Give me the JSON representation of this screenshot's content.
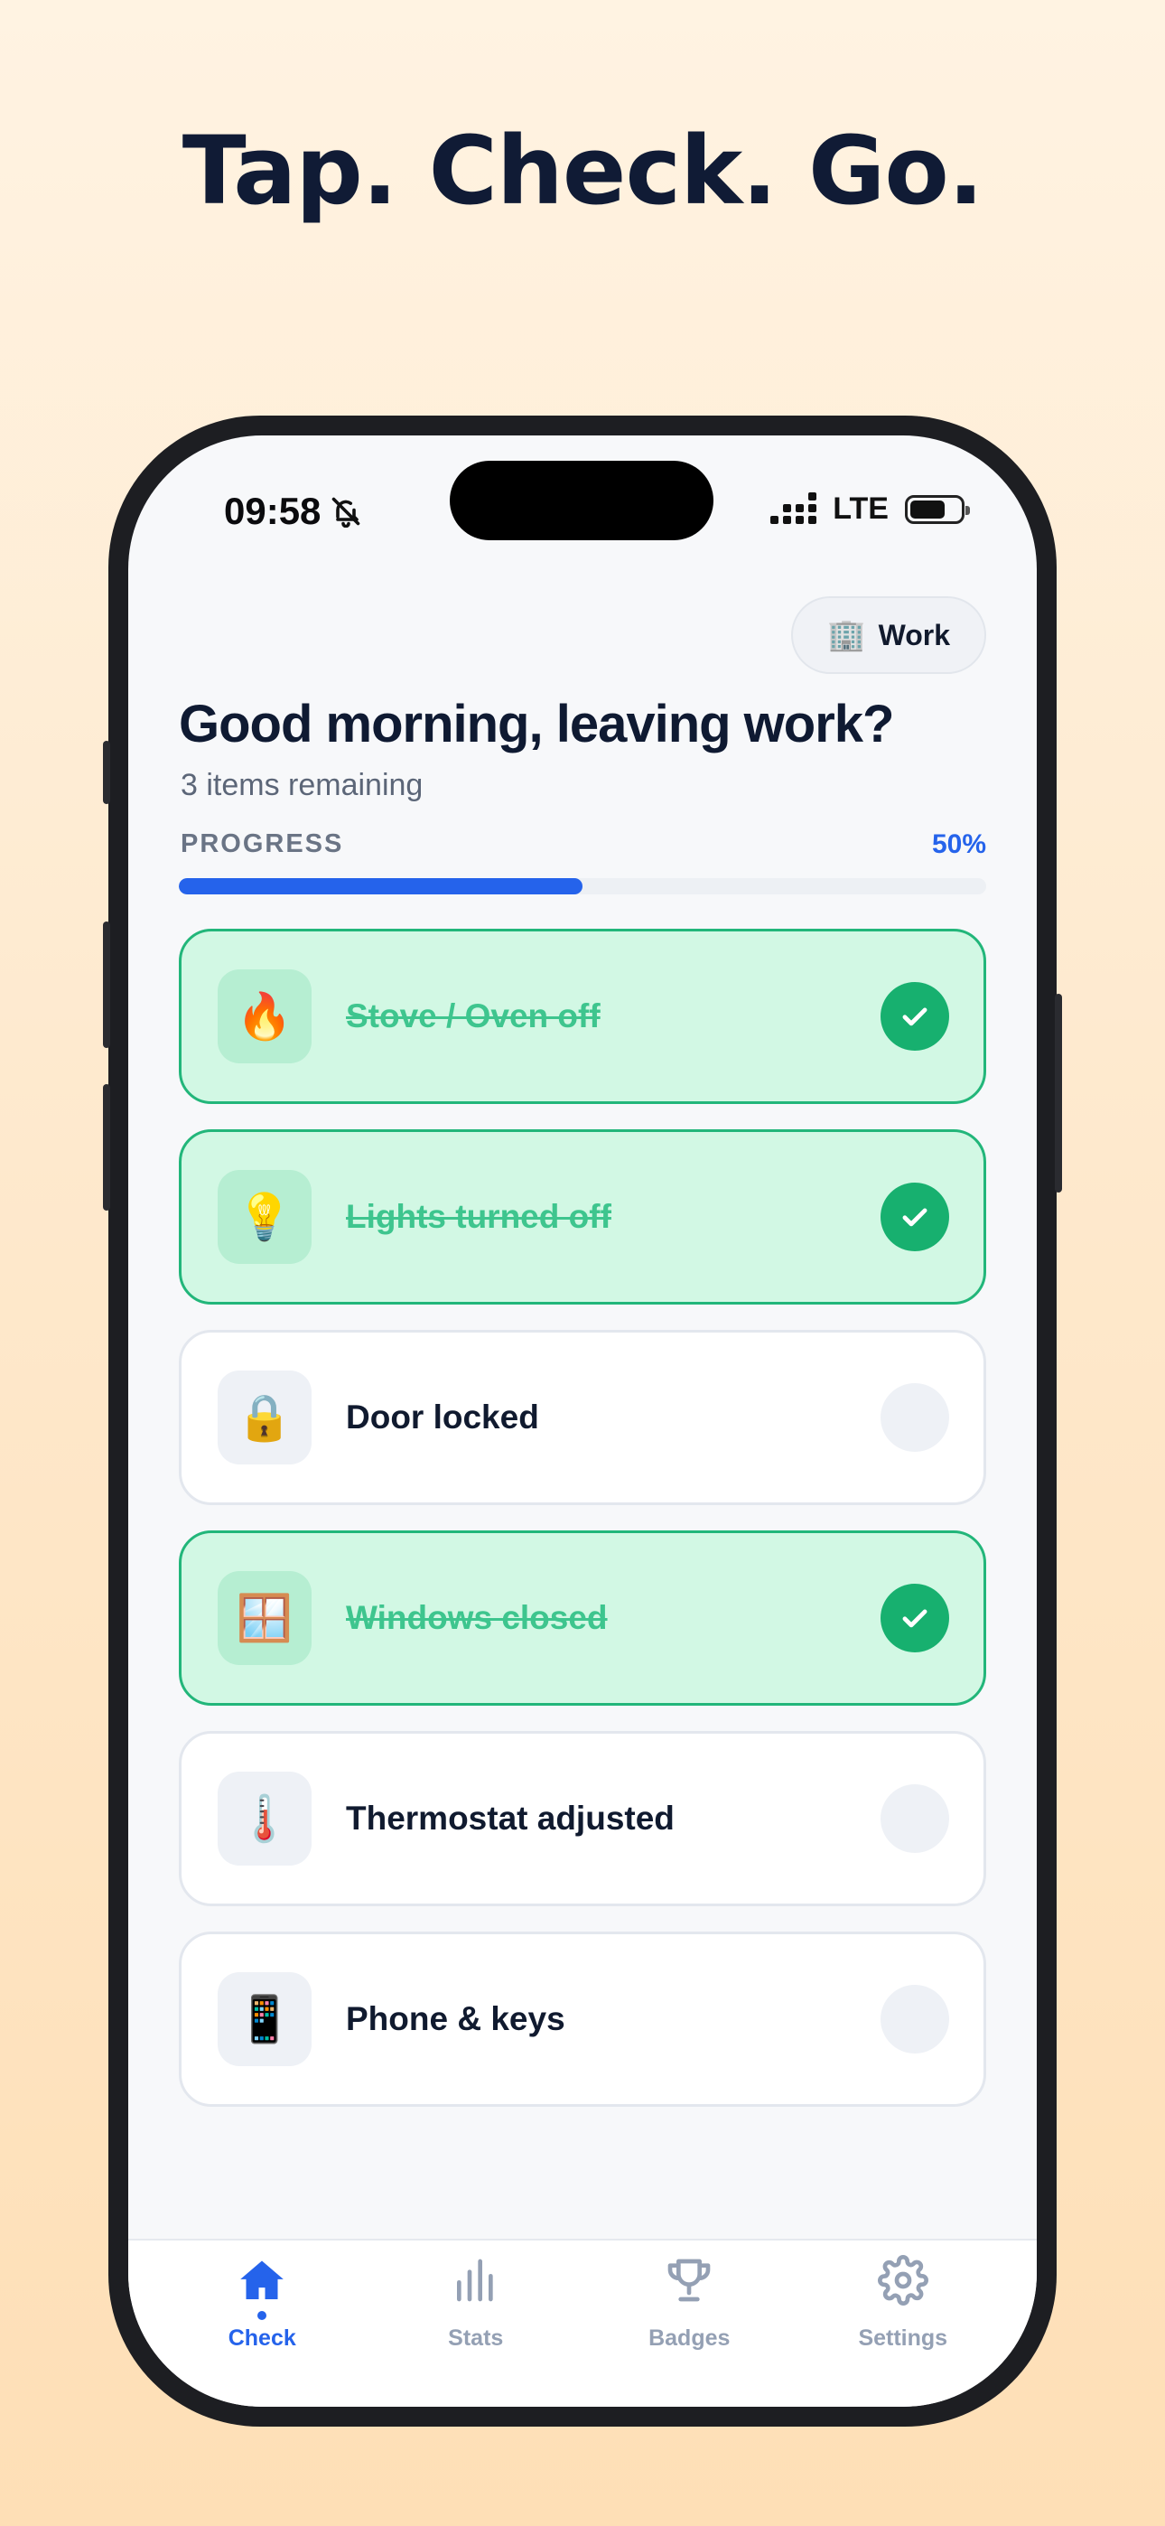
{
  "headline": "Tap. Check. Go.",
  "status_bar": {
    "time": "09:58",
    "network": "LTE"
  },
  "location_pill": {
    "icon": "🏢",
    "label": "Work"
  },
  "greeting": "Good morning, leaving work?",
  "remaining": "3 items remaining",
  "progress": {
    "label": "PROGRESS",
    "percent_text": "50%",
    "fraction": 0.5
  },
  "checklist": [
    {
      "icon": "🔥",
      "label": "Stove / Oven off",
      "done": true
    },
    {
      "icon": "💡",
      "label": "Lights turned off",
      "done": true
    },
    {
      "icon": "🔒",
      "label": "Door locked",
      "done": false
    },
    {
      "icon": "🪟",
      "label": "Windows closed",
      "done": true
    },
    {
      "icon": "🌡️",
      "label": "Thermostat adjusted",
      "done": false
    },
    {
      "icon": "📱",
      "label": "Phone & keys",
      "done": false
    }
  ],
  "tabs": [
    {
      "label": "Check",
      "icon": "home-icon",
      "active": true
    },
    {
      "label": "Stats",
      "icon": "bar-chart-icon",
      "active": false
    },
    {
      "label": "Badges",
      "icon": "trophy-icon",
      "active": false
    },
    {
      "label": "Settings",
      "icon": "gear-icon",
      "active": false
    }
  ],
  "colors": {
    "accent": "#2563eb",
    "done_bg": "#d2f8e4",
    "done_border": "#22b67a",
    "check": "#17b06f"
  }
}
